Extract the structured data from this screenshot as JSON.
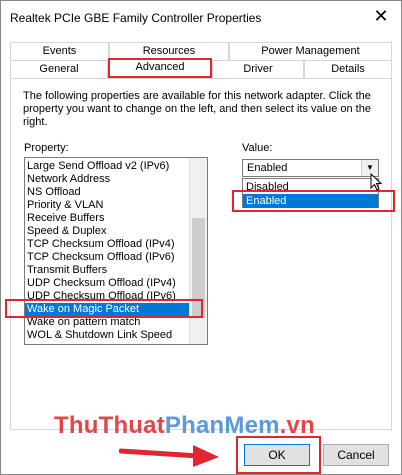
{
  "window": {
    "title": "Realtek PCIe GBE Family Controller Properties",
    "close_glyph": "✕"
  },
  "tabs": {
    "row1": [
      {
        "label": "Events"
      },
      {
        "label": "Resources"
      },
      {
        "label": "Power Management"
      }
    ],
    "row2": [
      {
        "label": "General"
      },
      {
        "label": "Advanced",
        "active": true
      },
      {
        "label": "Driver"
      },
      {
        "label": "Details"
      }
    ]
  },
  "description": "The following properties are available for this network adapter. Click the property you want to change on the left, and then select its value on the right.",
  "property": {
    "label": "Property:",
    "items": [
      "Large Send Offload v2 (IPv6)",
      "Network Address",
      "NS Offload",
      "Priority & VLAN",
      "Receive Buffers",
      "Speed & Duplex",
      "TCP Checksum Offload (IPv4)",
      "TCP Checksum Offload (IPv6)",
      "Transmit Buffers",
      "UDP Checksum Offload (IPv4)",
      "UDP Checksum Offload (IPv6)",
      "Wake on Magic Packet",
      "Wake on pattern match",
      "WOL & Shutdown Link Speed"
    ],
    "selected": "Wake on Magic Packet"
  },
  "value": {
    "label": "Value:",
    "current": "Enabled",
    "options": [
      {
        "label": "Disabled"
      },
      {
        "label": "Enabled",
        "selected": true
      }
    ]
  },
  "buttons": {
    "ok": "OK",
    "cancel": "Cancel"
  },
  "watermark": {
    "part1": "ThuThuat",
    "part2": "PhanMem",
    "part3": ".vn"
  },
  "colors": {
    "highlight": "#0078d7",
    "annotation_red": "#e0262f"
  }
}
